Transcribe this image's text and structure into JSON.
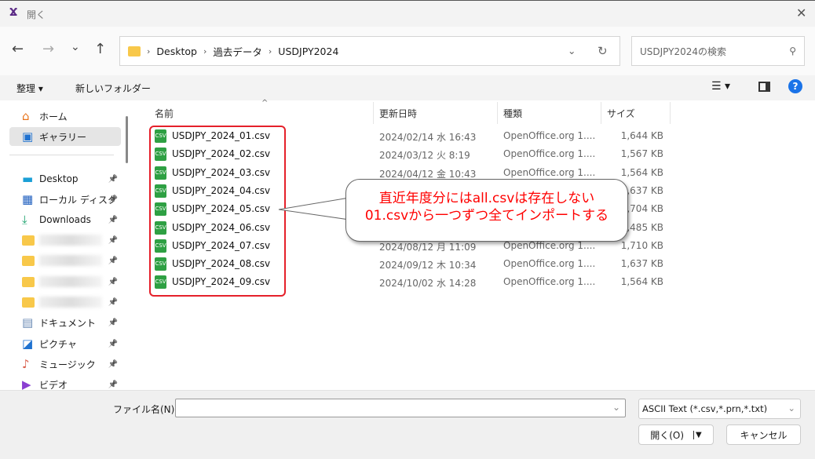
{
  "window": {
    "title": "開く",
    "app_icon": "libreoffice-icon",
    "close_icon": "close-icon"
  },
  "nav": {
    "back": "←",
    "forward": "→",
    "recent": "⌄",
    "up": "↑",
    "refresh": "↻"
  },
  "address": {
    "crumbs": [
      "Desktop",
      "過去データ",
      "USDJPY2024"
    ]
  },
  "search": {
    "placeholder": "USDJPY2024の検索"
  },
  "toolbar": {
    "organize": "整理 ▾",
    "new_folder": "新しいフォルダー"
  },
  "sidebar": {
    "items": [
      {
        "label": "ホーム",
        "icon": "home-icon"
      },
      {
        "label": "ギャラリー",
        "icon": "gallery-icon",
        "selected": true
      },
      {
        "label": "Desktop",
        "icon": "desktop-icon",
        "pinned": true
      },
      {
        "label": "ローカル ディスク",
        "icon": "disk-icon",
        "pinned": true
      },
      {
        "label": "Downloads",
        "icon": "download-icon",
        "pinned": true
      },
      {
        "label": "",
        "icon": "folder-icon",
        "pinned": true
      },
      {
        "label": "",
        "icon": "folder-icon",
        "pinned": true
      },
      {
        "label": "",
        "icon": "folder-icon",
        "pinned": true
      },
      {
        "label": "",
        "icon": "folder-icon",
        "pinned": true
      },
      {
        "label": "ドキュメント",
        "icon": "documents-icon",
        "pinned": true
      },
      {
        "label": "ピクチャ",
        "icon": "pictures-icon",
        "pinned": true
      },
      {
        "label": "ミュージック",
        "icon": "music-icon",
        "pinned": true
      },
      {
        "label": "ビデオ",
        "icon": "video-icon",
        "pinned": true
      }
    ]
  },
  "columns": {
    "name": "名前",
    "date": "更新日時",
    "type": "種類",
    "size": "サイズ"
  },
  "files": [
    {
      "name": "USDJPY_2024_01.csv",
      "date": "2024/02/14 水 16:43",
      "type": "OpenOffice.org 1....",
      "size": "1,644 KB"
    },
    {
      "name": "USDJPY_2024_02.csv",
      "date": "2024/03/12 火 8:19",
      "type": "OpenOffice.org 1....",
      "size": "1,567 KB"
    },
    {
      "name": "USDJPY_2024_03.csv",
      "date": "2024/04/12 金 10:43",
      "type": "OpenOffice.org 1....",
      "size": "1,564 KB"
    },
    {
      "name": "USDJPY_2024_04.csv",
      "date": "",
      "type": "",
      "size": "1,637 KB"
    },
    {
      "name": "USDJPY_2024_05.csv",
      "date": "",
      "type": "",
      "size": "1,704 KB"
    },
    {
      "name": "USDJPY_2024_06.csv",
      "date": "",
      "type": "",
      "size": "1,485 KB"
    },
    {
      "name": "USDJPY_2024_07.csv",
      "date": "2024/08/12 月 11:09",
      "type": "OpenOffice.org 1....",
      "size": "1,710 KB"
    },
    {
      "name": "USDJPY_2024_08.csv",
      "date": "2024/09/12 木 10:34",
      "type": "OpenOffice.org 1....",
      "size": "1,637 KB"
    },
    {
      "name": "USDJPY_2024_09.csv",
      "date": "2024/10/02 水 14:28",
      "type": "OpenOffice.org 1....",
      "size": "1,564 KB"
    }
  ],
  "callout": {
    "line1": "直近年度分にはall.csvは存在しない",
    "line2": "01.csvから一つずつ全てインポートする",
    "color": "#ff0000"
  },
  "bottom": {
    "filename_label": "ファイル名(N):",
    "filename_value": "",
    "filter": "ASCII Text (*.csv,*.prn,*.txt)",
    "open": "開く(O)",
    "cancel": "キャンセル"
  }
}
